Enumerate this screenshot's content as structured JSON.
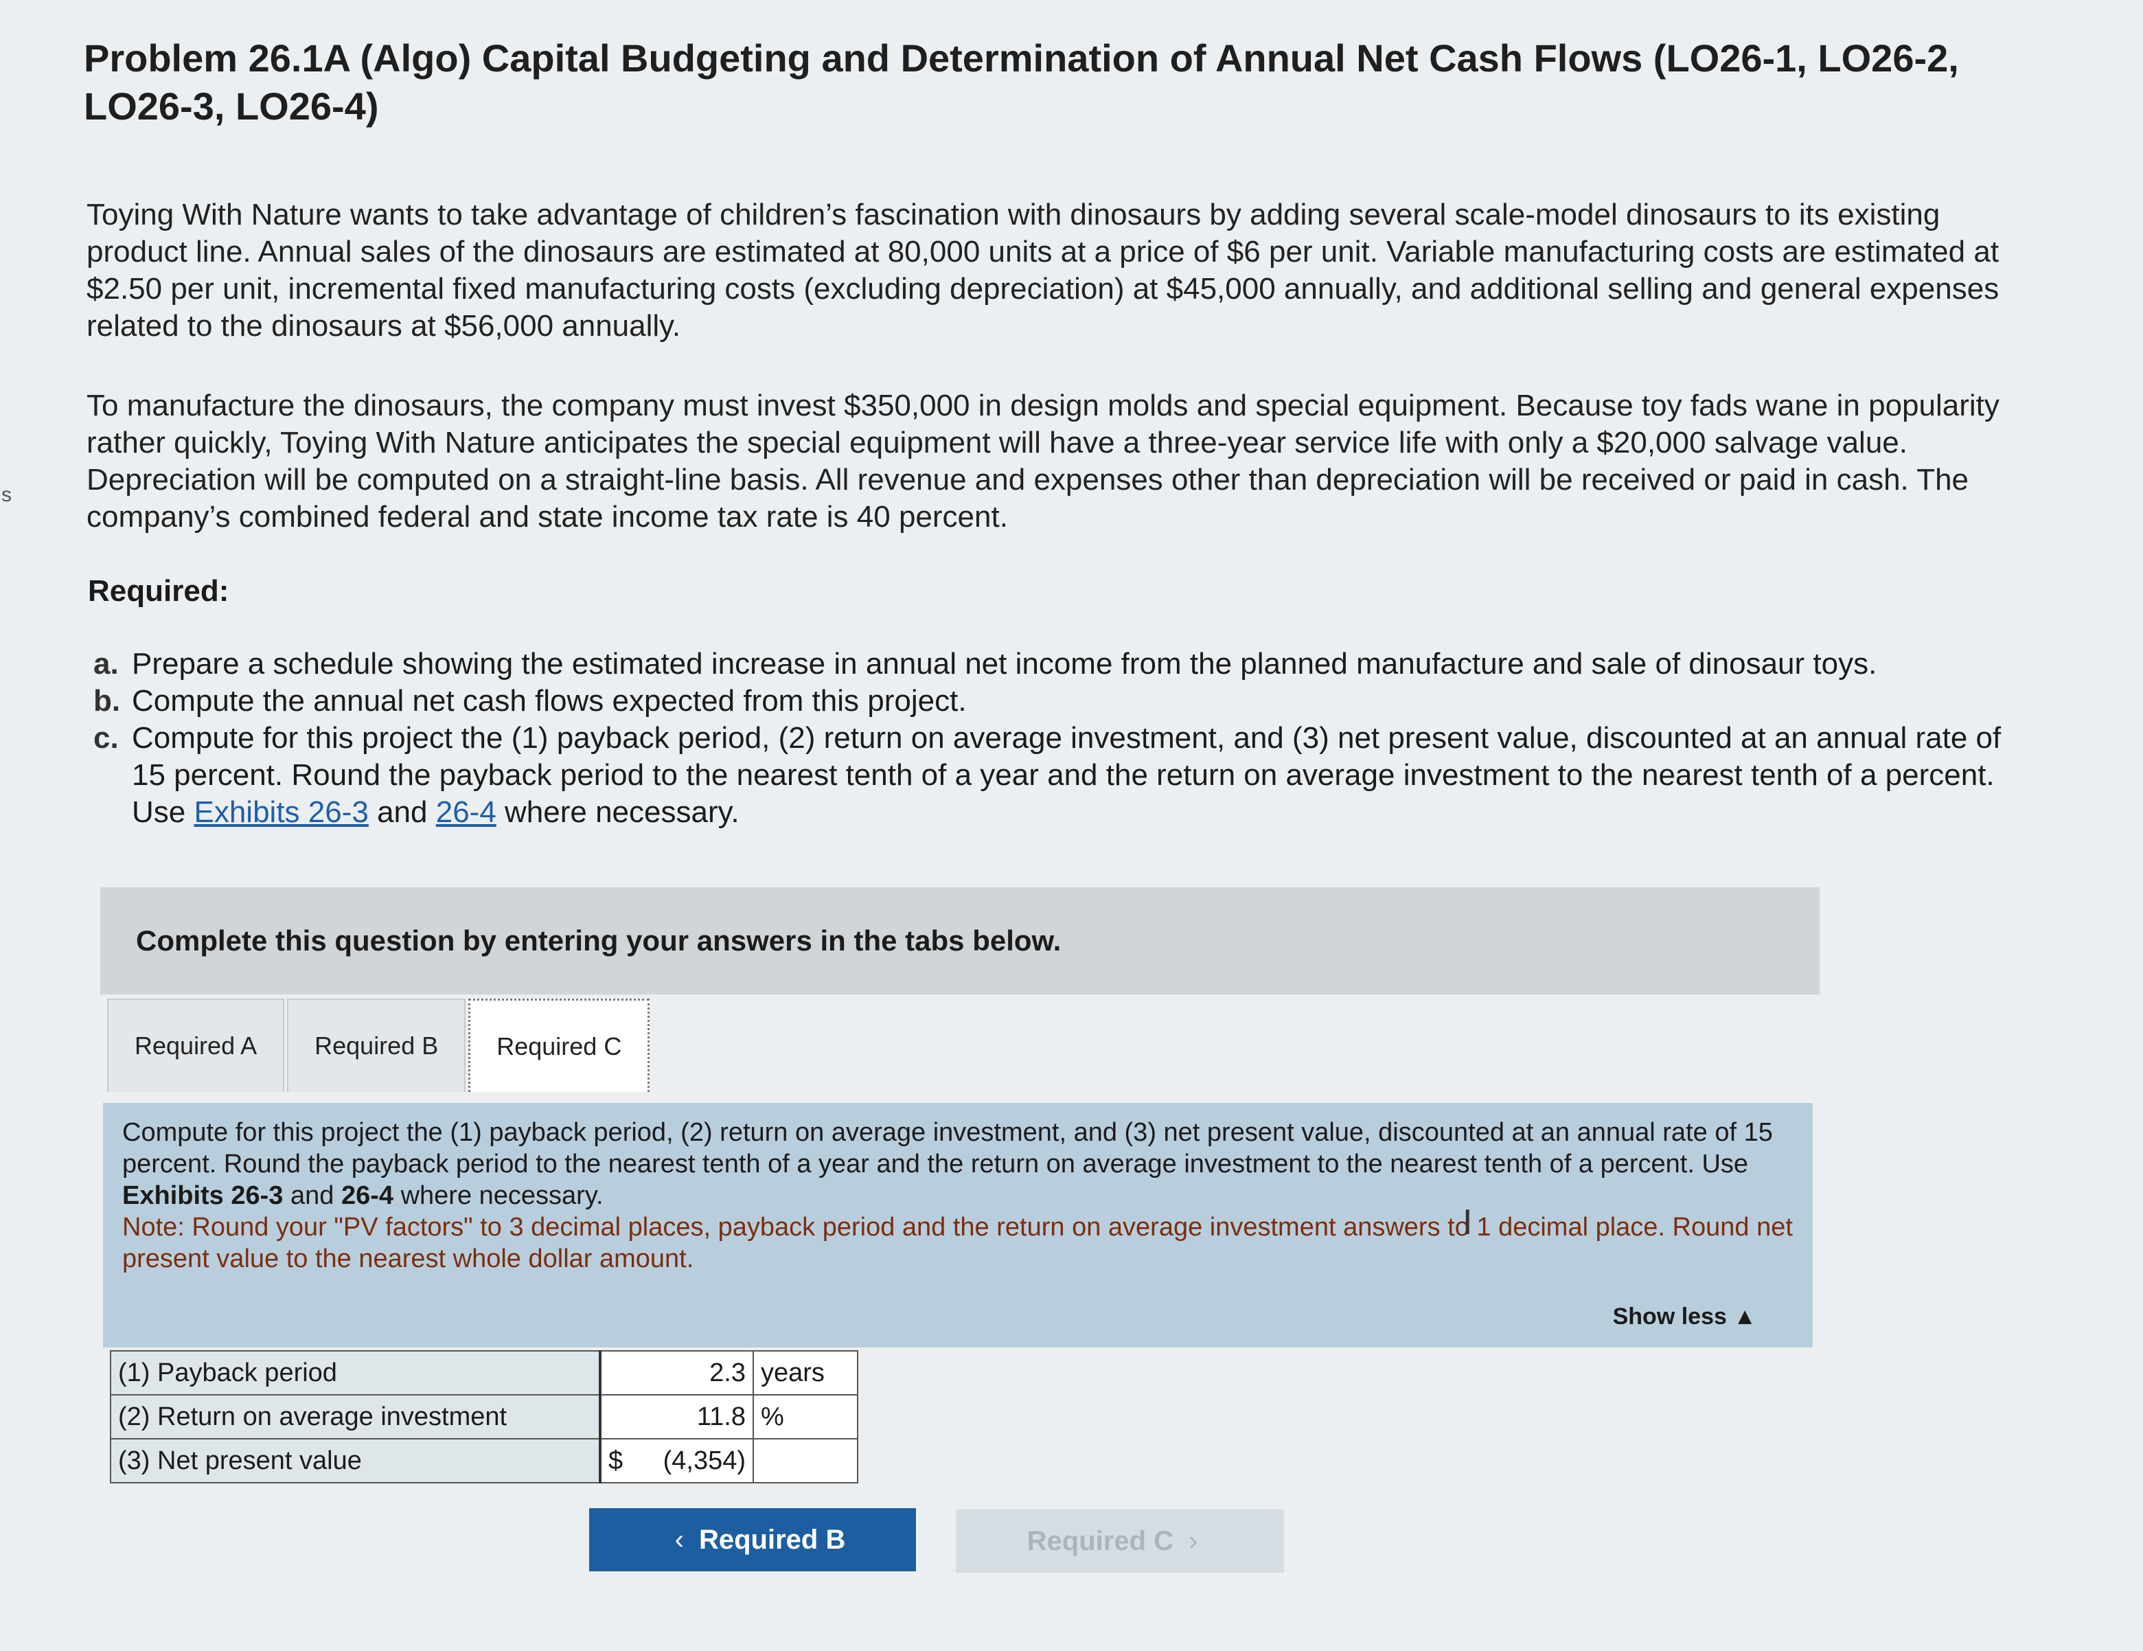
{
  "edge_glyph": "s",
  "problem": {
    "title": "Problem 26.1A (Algo) Capital Budgeting and Determination of Annual Net Cash Flows (LO26-1, LO26-2, LO26-3, LO26-4)",
    "paragraph1": "Toying With Nature wants to take advantage of children’s fascination with dinosaurs by adding several scale-model dinosaurs to its existing product line. Annual sales of the dinosaurs are estimated at 80,000 units at a price of $6 per unit. Variable manufacturing costs are estimated at $2.50 per unit, incremental fixed manufacturing costs (excluding depreciation) at $45,000 annually, and additional selling and general expenses related to the dinosaurs at $56,000 annually.",
    "paragraph2": "To manufacture the dinosaurs, the company must invest $350,000 in design molds and special equipment. Because toy fads wane in popularity rather quickly, Toying With Nature anticipates the special equipment will have a three-year service life with only a $20,000 salvage value. Depreciation will be computed on a straight-line basis. All revenue and expenses other than depreciation will be received or paid in cash. The company’s combined federal and state income tax rate is 40 percent.",
    "required_heading": "Required:",
    "requirements": [
      {
        "letter": "a.",
        "text": "Prepare a schedule showing the estimated increase in annual net income from the planned manufacture and sale of dinosaur toys."
      },
      {
        "letter": "b.",
        "text": "Compute the annual net cash flows expected from this project."
      },
      {
        "letter": "c.",
        "text": "Compute for this project the (1) payback period, (2) return on average investment, and (3) net present value, discounted at an annual rate of 15 percent. Round the payback period to the nearest tenth of a year and the return on average investment to the nearest tenth of a percent. Use "
      }
    ],
    "req_c_link1": "Exhibits 26-3",
    "req_c_and": " and ",
    "req_c_link2": "26-4",
    "req_c_tail": " where necessary."
  },
  "instruction": "Complete this question by entering your answers in the tabs below.",
  "tabs": [
    {
      "label": "Required A"
    },
    {
      "label": "Required B"
    },
    {
      "label": "Required C"
    }
  ],
  "panel": {
    "text_before": "Compute for this project the (1) payback period, (2) return on average investment, and (3) net present value, discounted at an annual rate of 15 percent. Round the payback period to the nearest tenth of a year and the return on average investment to the nearest tenth of a percent. Use ",
    "bold1": "Exhibits 26-3",
    "and": " and ",
    "bold2": "26-4",
    "text_after": " where necessary.",
    "note": "Note: Round your \"PV factors\" to 3 decimal places, payback period and the return on average investment answers to 1 decimal place. Round net present value to the nearest whole dollar amount.",
    "show_less": "Show less ▲"
  },
  "answers": [
    {
      "label": "(1) Payback period",
      "value": "2.3",
      "unit": "years"
    },
    {
      "label": "(2) Return on average investment",
      "value": "11.8",
      "unit": "%"
    },
    {
      "label": "(3) Net present value",
      "currency": "$",
      "value": "(4,354)",
      "unit": ""
    }
  ],
  "nav": {
    "prev_label": "Required B",
    "next_label": "Required C",
    "prev_chevron": "‹",
    "next_chevron": "›"
  },
  "cursor_glyph": "I"
}
